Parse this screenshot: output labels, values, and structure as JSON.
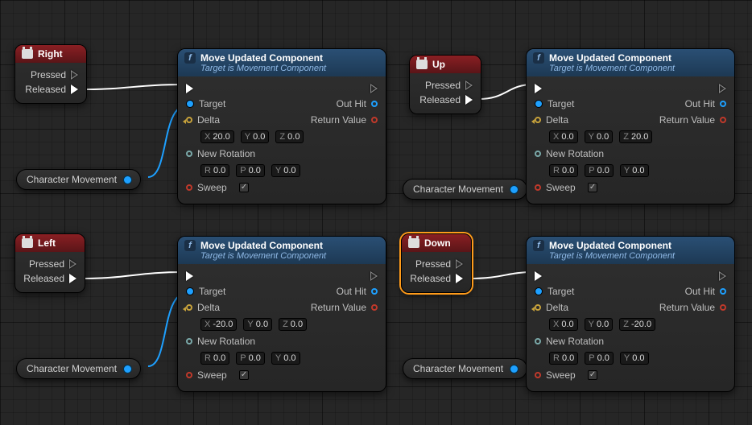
{
  "events": {
    "right": {
      "title": "Right",
      "pressed": "Pressed",
      "released": "Released"
    },
    "up": {
      "title": "Up",
      "pressed": "Pressed",
      "released": "Released"
    },
    "left": {
      "title": "Left",
      "pressed": "Pressed",
      "released": "Released"
    },
    "down": {
      "title": "Down",
      "pressed": "Pressed",
      "released": "Released"
    }
  },
  "var": {
    "right": "Character Movement",
    "up": "Character Movement",
    "left": "Character Movement",
    "down": "Character Movement"
  },
  "func": {
    "title": "Move Updated Component",
    "subtitle": "Target is Movement Component",
    "target": "Target",
    "delta": "Delta",
    "newrot": "New Rotation",
    "sweep": "Sweep",
    "outhit": "Out Hit",
    "retval": "Return Value",
    "right": {
      "dx": "20.0",
      "dy": "0.0",
      "dz": "0.0",
      "rr": "0.0",
      "rp": "0.0",
      "ry": "0.0"
    },
    "up": {
      "dx": "0.0",
      "dy": "0.0",
      "dz": "20.0",
      "rr": "0.0",
      "rp": "0.0",
      "ry": "0.0"
    },
    "left": {
      "dx": "-20.0",
      "dy": "0.0",
      "dz": "0.0",
      "rr": "0.0",
      "rp": "0.0",
      "ry": "0.0"
    },
    "down": {
      "dx": "0.0",
      "dy": "0.0",
      "dz": "-20.0",
      "rr": "0.0",
      "rp": "0.0",
      "ry": "0.0"
    }
  }
}
